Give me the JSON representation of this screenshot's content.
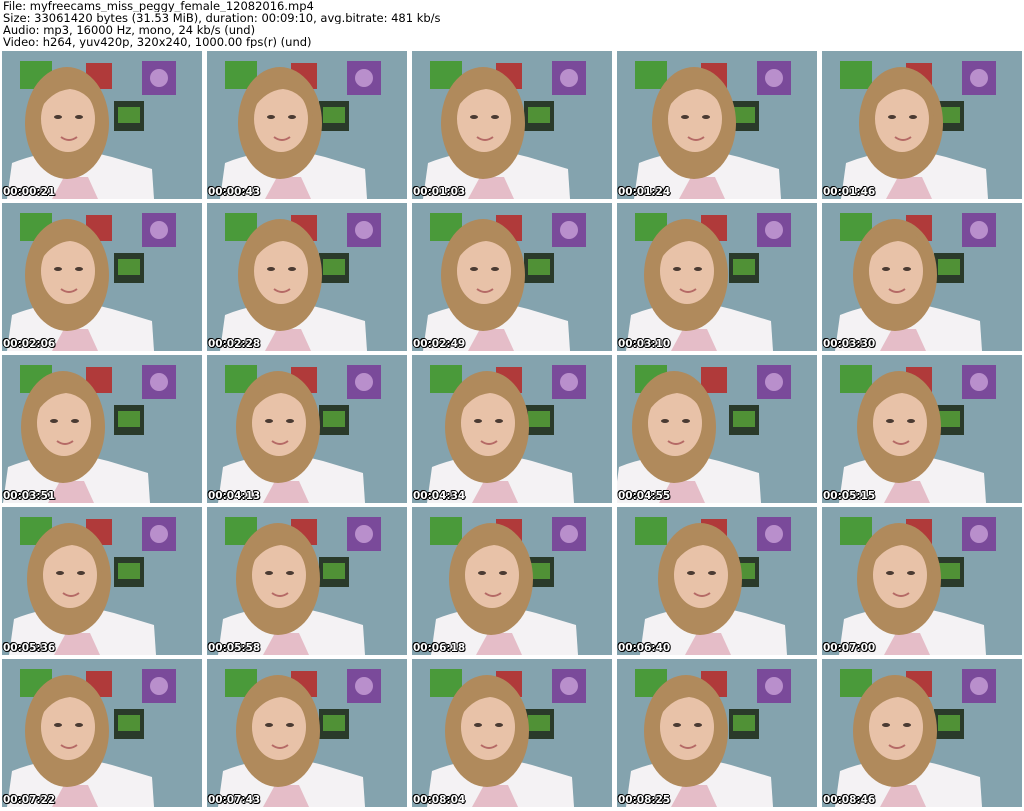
{
  "info": {
    "file": "File: myfreecams_miss_peggy_female_12082016.mp4",
    "size": "Size: 33061420 bytes (31.53 MiB), duration: 00:09:10, avg.bitrate: 481 kb/s",
    "audio": "Audio: mp3, 16000 Hz, mono, 24 kb/s (und)",
    "video": "Video: h264, yuv420p, 320x240, 1000.00 fps(r) (und)"
  },
  "thumbnails": [
    {
      "timestamp": "00:00:21"
    },
    {
      "timestamp": "00:00:43"
    },
    {
      "timestamp": "00:01:03"
    },
    {
      "timestamp": "00:01:24"
    },
    {
      "timestamp": "00:01:46"
    },
    {
      "timestamp": "00:02:06"
    },
    {
      "timestamp": "00:02:28"
    },
    {
      "timestamp": "00:02:49"
    },
    {
      "timestamp": "00:03:10"
    },
    {
      "timestamp": "00:03:30"
    },
    {
      "timestamp": "00:03:51"
    },
    {
      "timestamp": "00:04:13"
    },
    {
      "timestamp": "00:04:34"
    },
    {
      "timestamp": "00:04:55"
    },
    {
      "timestamp": "00:05:15"
    },
    {
      "timestamp": "00:05:36"
    },
    {
      "timestamp": "00:05:58"
    },
    {
      "timestamp": "00:06:18"
    },
    {
      "timestamp": "00:06:40"
    },
    {
      "timestamp": "00:07:00"
    },
    {
      "timestamp": "00:07:22"
    },
    {
      "timestamp": "00:07:43"
    },
    {
      "timestamp": "00:08:04"
    },
    {
      "timestamp": "00:08:25"
    },
    {
      "timestamp": "00:08:46"
    }
  ],
  "colors": {
    "wall": "#8fb0ba",
    "hair": "#b08a5c",
    "skin": "#e8c2a8",
    "shirt": "#f4f2f4",
    "shirt_print": "#e2b4bf",
    "poster_green": "#4a9a3a",
    "poster_purple": "#7a4a9a",
    "poster_red": "#b03a3a",
    "poster_dark": "#2a3a2a",
    "timestamp_text": "#ffffff"
  }
}
